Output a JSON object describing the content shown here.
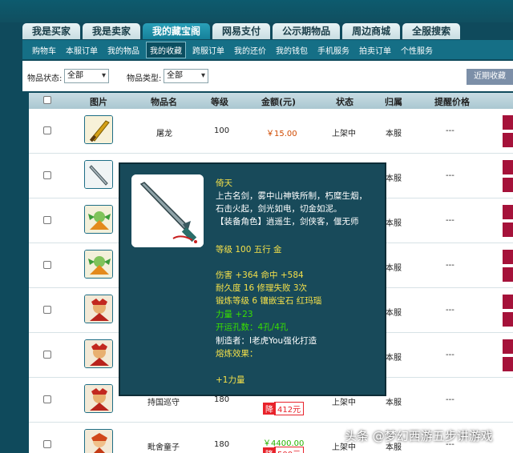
{
  "tabs": [
    "我是买家",
    "我是卖家",
    "我的藏宝阁",
    "网易支付",
    "公示期物品",
    "周边商城",
    "全服搜索"
  ],
  "subnav": [
    "购物车",
    "本服订单",
    "我的物品",
    "我的收藏",
    "跨服订单",
    "我的还价",
    "我的钱包",
    "手机服务",
    "拍卖订单",
    "个性服务"
  ],
  "filter": {
    "status_label": "物品状态:",
    "status_value": "全部",
    "type_label": "物品类型:",
    "type_value": "全部",
    "recent_label": "近期收藏"
  },
  "table": {
    "headers": [
      "图片",
      "物品名",
      "等级",
      "金额(元)",
      "状态",
      "归属",
      "提醒价格"
    ],
    "rows": [
      {
        "name": "屠龙",
        "level": "100",
        "price": "￥15.00",
        "status": "上架中",
        "owner": "本服",
        "remind": "---",
        "icon": "golden-blade-icon"
      },
      {
        "name": "",
        "level": "",
        "price": "",
        "status": "",
        "owner": "本服",
        "remind": "---",
        "icon": "sword-icon"
      },
      {
        "name": "",
        "level": "",
        "price": "",
        "status": "",
        "owner": "本服",
        "remind": "---",
        "icon": "green-monster-icon"
      },
      {
        "name": "",
        "level": "",
        "price": "",
        "status": "",
        "owner": "本服",
        "remind": "---",
        "icon": "green-monster-icon"
      },
      {
        "name": "",
        "level": "",
        "price": "",
        "status": "",
        "owner": "本服",
        "remind": "---",
        "icon": "red-guardian-icon"
      },
      {
        "name": "",
        "level": "",
        "price": "",
        "status": "",
        "owner": "本服",
        "remind": "---",
        "icon": "red-guardian-icon"
      },
      {
        "name": "持国巡守",
        "level": "180",
        "price": "",
        "status": "上架中",
        "owner": "本服",
        "remind": "---",
        "icon": "red-guardian-icon",
        "discount_badge": "降",
        "discount": "412元"
      },
      {
        "name": "毗舍童子",
        "level": "180",
        "price": "￥4400.00",
        "status": "上架中",
        "owner": "本服",
        "remind": "---",
        "icon": "child-icon",
        "discount_badge": "降",
        "discount": "500元"
      }
    ]
  },
  "tooltip": {
    "name": "倚天",
    "desc": [
      "上古名剑，雾中山神铁所制，朽糜生烟，",
      "石击火起，剑光如电，切金如泥。",
      "【装备角色】逍遥生，剑侠客，偃无师"
    ],
    "level_line": "等级 100 五行 金",
    "stats": [
      {
        "text": "伤害 +364 命中 +584",
        "color": "yellow"
      },
      {
        "text": "耐久度 16 修理失败 3次",
        "color": "yellow"
      },
      {
        "text": "锻炼等级 6 镶嵌宝石 红玛瑙",
        "color": "yellow"
      },
      {
        "text": "力量 +23",
        "color": "green"
      },
      {
        "text": "开运孔数：4孔/4孔",
        "color": "green"
      },
      {
        "text": "制造者：I老虎You强化打造",
        "color": "white"
      },
      {
        "text": "熔炼效果：",
        "color": "yellow"
      },
      {
        "text": "",
        "color": "white"
      },
      {
        "text": "+1力量",
        "color": "yellow"
      }
    ]
  },
  "watermark": "头条 @梦幻西游五步讲游戏"
}
